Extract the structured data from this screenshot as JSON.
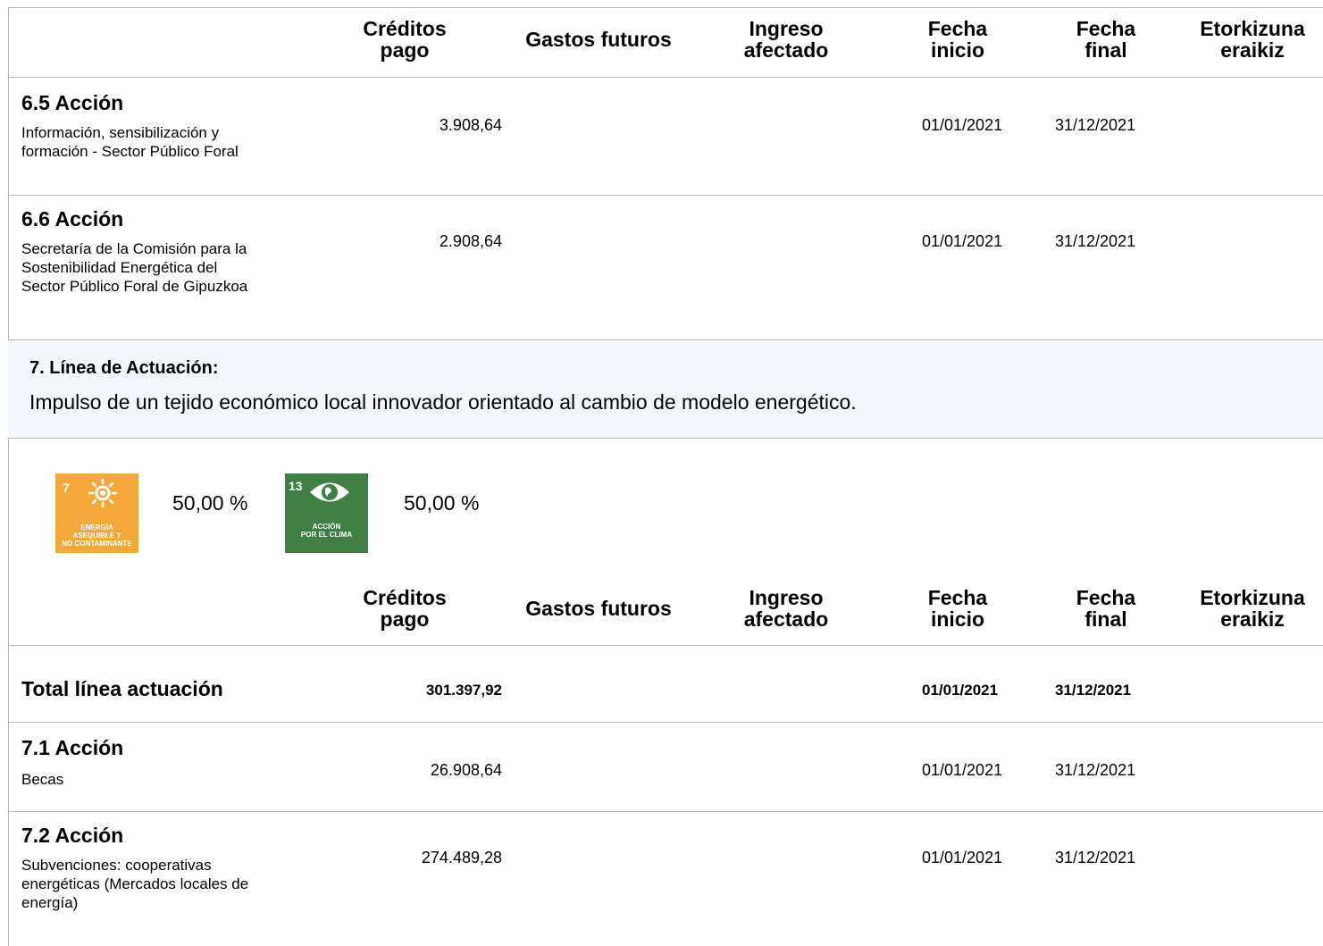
{
  "columns": {
    "creditos": [
      "Créditos",
      "pago"
    ],
    "gastos": "Gastos futuros",
    "ingreso": [
      "Ingreso",
      "afectado"
    ],
    "fecha_inicio": [
      "Fecha",
      "inicio"
    ],
    "fecha_final": [
      "Fecha",
      "final"
    ],
    "etorkizuna": [
      "Etorkizuna",
      "eraikiz"
    ]
  },
  "actions_6": [
    {
      "title": "6.5 Acción",
      "desc": [
        "Información, sensibilización y",
        "formación - Sector Público Foral"
      ],
      "creditos": "3.908,64",
      "fecha_inicio": "01/01/2021",
      "fecha_final": "31/12/2021"
    },
    {
      "title": "6.6 Acción",
      "desc": [
        "Secretaría de la Comisión para la",
        "Sostenibilidad Energética del",
        "Sector Público Foral de Gipuzkoa"
      ],
      "creditos": "2.908,64",
      "fecha_inicio": "01/01/2021",
      "fecha_final": "31/12/2021"
    }
  ],
  "linea7": {
    "heading": "7. Línea de Actuación:",
    "text": "Impulso de un tejido económico local innovador orientado al cambio de modelo energético."
  },
  "sdgs": [
    {
      "number": "7",
      "caption": [
        "ENERGÍA",
        "ASEQUIBLE Y",
        "NO CONTAMINANTE"
      ],
      "percent": "50,00 %",
      "color": "#f5a83a",
      "icon": "sun-icon"
    },
    {
      "number": "13",
      "caption": [
        "ACCIÓN",
        "POR EL CLIMA"
      ],
      "percent": "50,00 %",
      "color": "#3f7e44",
      "icon": "earth-eye-icon"
    }
  ],
  "total": {
    "label": "Total línea actuación",
    "creditos": "301.397,92",
    "fecha_inicio": "01/01/2021",
    "fecha_final": "31/12/2021"
  },
  "actions_7": [
    {
      "title": "7.1 Acción",
      "desc": [
        "Becas"
      ],
      "creditos": "26.908,64",
      "fecha_inicio": "01/01/2021",
      "fecha_final": "31/12/2021"
    },
    {
      "title": "7.2 Acción",
      "desc": [
        "Subvenciones: cooperativas",
        "energéticas (Mercados locales de",
        "energía)"
      ],
      "creditos": "274.489,28",
      "fecha_inicio": "01/01/2021",
      "fecha_final": "31/12/2021"
    }
  ]
}
